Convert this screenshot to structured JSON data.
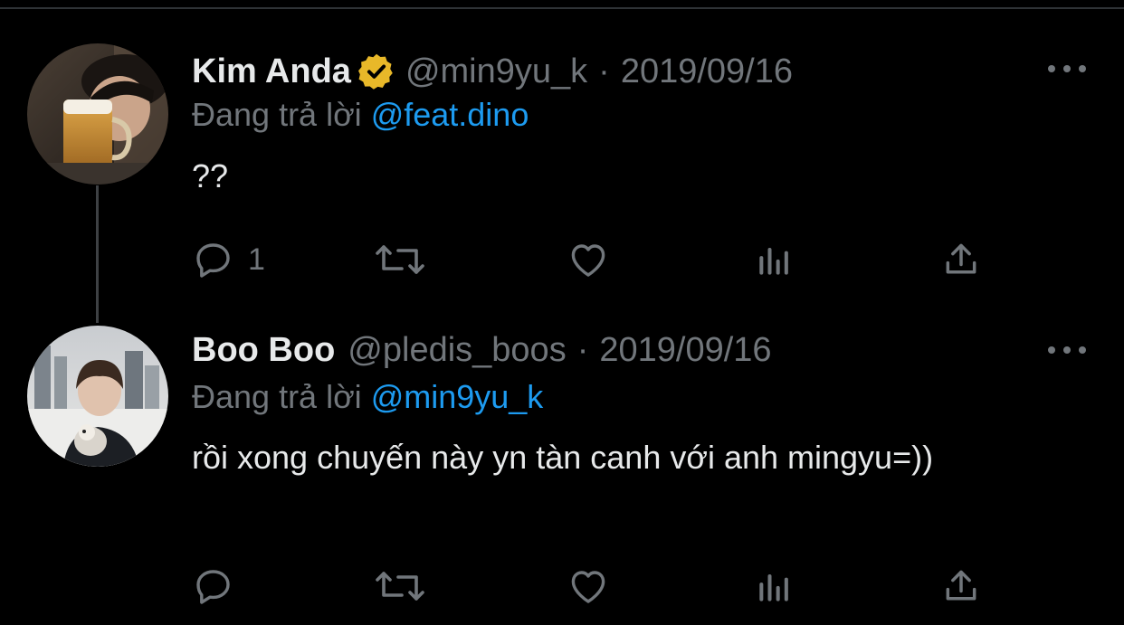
{
  "tweets": [
    {
      "display_name": "Kim Anda",
      "verified": true,
      "handle": "@min9yu_k",
      "separator": "·",
      "date": "2019/09/16",
      "reply_prefix": "Đang trả lời",
      "reply_to": "@feat.dino",
      "text": "??",
      "reply_count": "1",
      "avatar_icon": "profile-photo-man-with-beer"
    },
    {
      "display_name": "Boo Boo",
      "verified": false,
      "handle": "@pledis_boos",
      "separator": "·",
      "date": "2019/09/16",
      "reply_prefix": "Đang trả lời",
      "reply_to": "@min9yu_k",
      "text": "rồi xong chuyến này yn tàn canh với anh mingyu=))",
      "reply_count": "",
      "avatar_icon": "profile-photo-person-with-dog"
    }
  ],
  "colors": {
    "background": "#000000",
    "primary_text": "#e7e9ea",
    "secondary_text": "#71767b",
    "link": "#1d9bf0",
    "verified_gold": "#e8b829",
    "thread_line": "#3e4144"
  },
  "icons": {
    "reply": "reply-icon",
    "retweet": "retweet-icon",
    "like": "like-icon",
    "views": "views-icon",
    "share": "share-icon",
    "more": "more-icon",
    "verified": "verified-badge-icon"
  }
}
